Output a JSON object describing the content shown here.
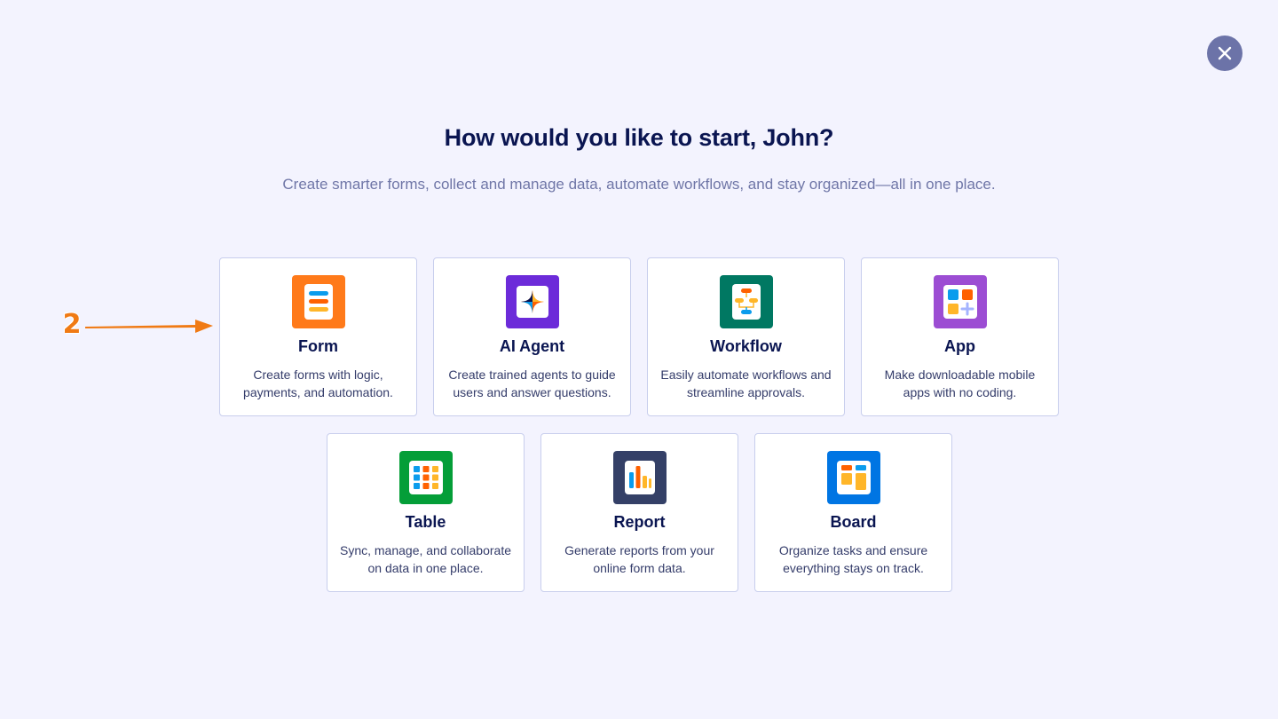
{
  "dialog": {
    "title": "How would you like to start, John?",
    "subtitle": "Create smarter forms, collect and manage data, automate workflows, and stay organized—all in one place."
  },
  "options": [
    {
      "name": "Form",
      "description": "Create forms with logic, payments, and automation.",
      "color": "#ff7a1a",
      "icon": "form-icon"
    },
    {
      "name": "AI Agent",
      "description": "Create trained agents to guide users and answer questions.",
      "color": "#6c2bd9",
      "icon": "ai-agent-icon"
    },
    {
      "name": "Workflow",
      "description": "Easily automate workflows and streamline approvals.",
      "color": "#007862",
      "icon": "workflow-icon"
    },
    {
      "name": "App",
      "description": "Make downloadable mobile apps with no coding.",
      "color": "#9c4dd3",
      "icon": "app-icon"
    },
    {
      "name": "Table",
      "description": "Sync, manage, and collaborate on data in one place.",
      "color": "#049e38",
      "icon": "table-icon"
    },
    {
      "name": "Report",
      "description": "Generate reports from your online form data.",
      "color": "#344067",
      "icon": "report-icon"
    },
    {
      "name": "Board",
      "description": "Organize tasks and ensure everything stays on track.",
      "color": "#0075e3",
      "icon": "board-icon"
    }
  ],
  "annotation": {
    "label": "2",
    "color": "#f07a14"
  },
  "close": {
    "icon": "close-icon"
  }
}
